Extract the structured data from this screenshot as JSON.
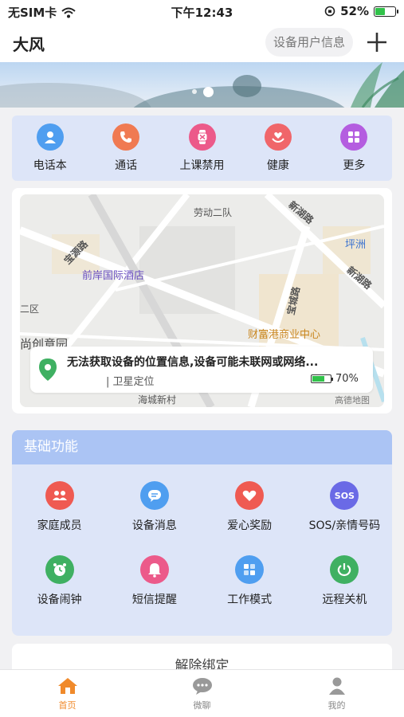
{
  "status_bar": {
    "carrier": "无SIM卡",
    "time": "下午12:43",
    "battery": "52%",
    "battery_level": 0.52
  },
  "header": {
    "title": "大风",
    "device_info_button": "设备用户信息",
    "add_icon": "plus-icon"
  },
  "banner": {
    "page_count": 2,
    "active_page": 2
  },
  "quick_actions": [
    {
      "label": "电话本",
      "icon": "contact-icon",
      "color": "#4f9ef0"
    },
    {
      "label": "通话",
      "icon": "phone-icon",
      "color": "#f07a52"
    },
    {
      "label": "上课禁用",
      "icon": "watch-icon",
      "color": "#ec5a8a"
    },
    {
      "label": "健康",
      "icon": "heart-hand-icon",
      "color": "#f0666a"
    },
    {
      "label": "更多",
      "icon": "grid-icon",
      "color": "#b45de0"
    }
  ],
  "map": {
    "labels": {
      "l1": "劳动二队",
      "l2": "新湖路",
      "l3": "宝源路",
      "l4": "坪洲",
      "l5": "前岸国际酒店",
      "l6": "新湖路",
      "l7": "二区",
      "l8": "宝城路",
      "l9": "尚创意园",
      "l10": "财富港商业中心",
      "l11": "海城新村",
      "l12": "高德地图"
    },
    "location_message": "无法获取设备的位置信息,设备可能未联网或网络...",
    "location_type": "| 卫星定位",
    "device_battery": "70%",
    "device_battery_level": 0.7
  },
  "basic_functions": {
    "title": "基础功能",
    "items": [
      {
        "label": "家庭成员",
        "icon": "family-icon",
        "color": "#ef5a52"
      },
      {
        "label": "设备消息",
        "icon": "message-icon",
        "color": "#4f9ef0"
      },
      {
        "label": "爱心奖励",
        "icon": "love-icon",
        "color": "#ef5a52"
      },
      {
        "label": "SOS/亲情号码",
        "icon": "sos-icon",
        "color": "#6a6ae6",
        "icon_text": "SOS"
      },
      {
        "label": "设备闹钟",
        "icon": "alarm-icon",
        "color": "#3fb062"
      },
      {
        "label": "短信提醒",
        "icon": "bell-icon",
        "color": "#ec5a8a"
      },
      {
        "label": "工作模式",
        "icon": "mode-icon",
        "color": "#4f9ef0"
      },
      {
        "label": "远程关机",
        "icon": "power-icon",
        "color": "#3fb062"
      }
    ]
  },
  "unbind_label": "解除绑定",
  "tabbar": [
    {
      "label": "首页",
      "icon": "home-icon",
      "active": true
    },
    {
      "label": "微聊",
      "icon": "chat-icon",
      "active": false
    },
    {
      "label": "我的",
      "icon": "profile-icon",
      "active": false
    }
  ]
}
